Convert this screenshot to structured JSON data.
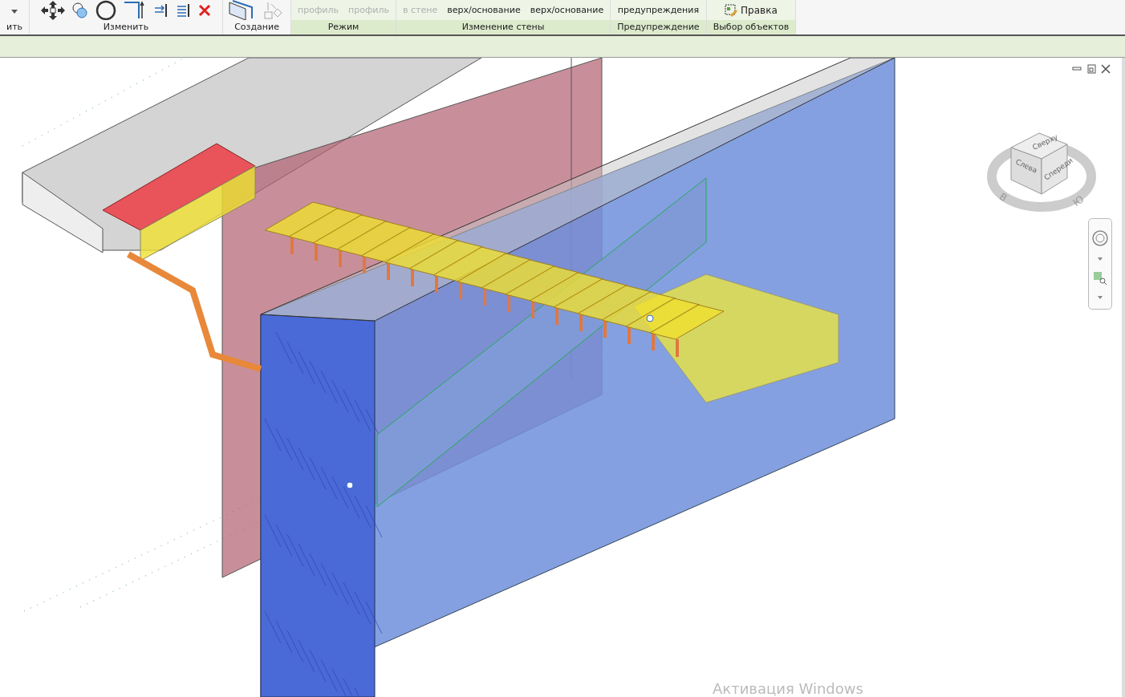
{
  "ribbon": {
    "panels": [
      {
        "label": "ить",
        "contextual": false,
        "tools": [
          {
            "kind": "dropdown"
          }
        ]
      },
      {
        "label": "Изменить",
        "contextual": false,
        "tools": [
          {
            "kind": "move"
          },
          {
            "kind": "copy"
          },
          {
            "kind": "circle"
          },
          {
            "kind": "split"
          },
          {
            "kind": "trim"
          },
          {
            "kind": "offset"
          },
          {
            "kind": "delete"
          }
        ]
      },
      {
        "label": "Создание",
        "contextual": false,
        "tools": [
          {
            "kind": "wall"
          },
          {
            "kind": "create"
          }
        ]
      },
      {
        "label": "Режим",
        "contextual": true,
        "tools": [
          {
            "kind": "text",
            "label": "профиль",
            "disabled": true
          },
          {
            "kind": "text",
            "label": "профиль",
            "disabled": true
          }
        ]
      },
      {
        "label": "Изменение стены",
        "contextual": true,
        "tools": [
          {
            "kind": "text",
            "label": "в стене",
            "disabled": true
          },
          {
            "kind": "text",
            "label": "верх/основание",
            "disabled": false
          },
          {
            "kind": "text",
            "label": "верх/основание",
            "disabled": false
          }
        ]
      },
      {
        "label": "Предупреждение",
        "contextual": true,
        "tools": [
          {
            "kind": "text",
            "label": "предупреждения",
            "disabled": false
          }
        ]
      },
      {
        "label": "Выбор объектов",
        "contextual": true,
        "tools": [
          {
            "kind": "edit",
            "label": "Правка",
            "disabled": false
          }
        ]
      }
    ]
  },
  "view_cube": {
    "top": "Сверху",
    "left": "Слева",
    "front": "Спереди",
    "compass": [
      "В",
      "Ю"
    ]
  },
  "watermark": "Активация Windows"
}
